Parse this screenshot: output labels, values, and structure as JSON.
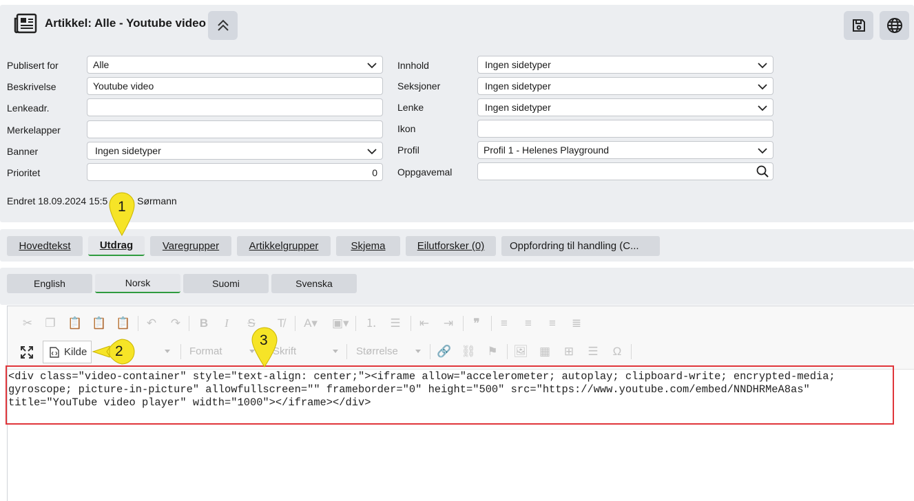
{
  "header": {
    "title": "Artikkel: Alle - Youtube video"
  },
  "form": {
    "left": [
      {
        "label": "Publisert for",
        "value": "Alle",
        "type": "select"
      },
      {
        "label": "Beskrivelse",
        "value": "Youtube video",
        "type": "text"
      },
      {
        "label": "Lenkeadr.",
        "value": "",
        "type": "text"
      },
      {
        "label": "Merkelapper",
        "value": "",
        "type": "text"
      },
      {
        "label": "Banner",
        "value": "Ingen sidetyper",
        "type": "select"
      },
      {
        "label": "Prioritet",
        "value": "0",
        "type": "number"
      }
    ],
    "right": [
      {
        "label": "Innhold",
        "value": "Ingen sidetyper",
        "type": "select"
      },
      {
        "label": "Seksjoner",
        "value": "Ingen sidetyper",
        "type": "select"
      },
      {
        "label": "Lenke",
        "value": "Ingen sidetyper",
        "type": "select"
      },
      {
        "label": "Ikon",
        "value": "",
        "type": "text"
      },
      {
        "label": "Profil",
        "value": "Profil 1 - Helenes Playground",
        "type": "select"
      },
      {
        "label": "Oppgavemal",
        "value": "",
        "type": "search"
      }
    ],
    "footer": "Endret 18.09.2024 15:5",
    "footer_tail": "ise Sørmann"
  },
  "tabs": [
    {
      "label": "Hovedtekst",
      "active": false
    },
    {
      "label": "Utdrag",
      "active": true
    },
    {
      "label": "Varegrupper",
      "active": false
    },
    {
      "label": "Artikkelgrupper",
      "active": false
    },
    {
      "label": "Skjema",
      "active": false
    },
    {
      "label": "Eilutforsker (0)",
      "active": false
    },
    {
      "label": "Oppfordring til handling (C...",
      "active": false
    }
  ],
  "languages": [
    {
      "label": "English",
      "active": false
    },
    {
      "label": "Norsk",
      "active": true
    },
    {
      "label": "Suomi",
      "active": false
    },
    {
      "label": "Svenska",
      "active": false
    }
  ],
  "editor": {
    "source_button": "Kilde",
    "format_placeholder": "Format",
    "font_placeholder": "Skrift",
    "size_placeholder": "Størrelse",
    "source_lines": [
      "<div class=\"video-container\" style=\"text-align: center;\"><iframe allow=\"accelerometer; autoplay; clipboard-write; encrypted-media;",
      "gyroscope; picture-in-picture\" allowfullscreen=\"\" frameborder=\"0\" height=\"500\" src=\"https://www.youtube.com/embed/NNDHRMeA8as\"",
      "title=\"YouTube video player\" width=\"1000\"></iframe></div>"
    ]
  },
  "callouts": [
    "1",
    "2",
    "3"
  ],
  "colors": {
    "accent_green": "#2e9b3e",
    "callout_yellow": "#f6e427",
    "highlight_red": "#e0353a"
  }
}
